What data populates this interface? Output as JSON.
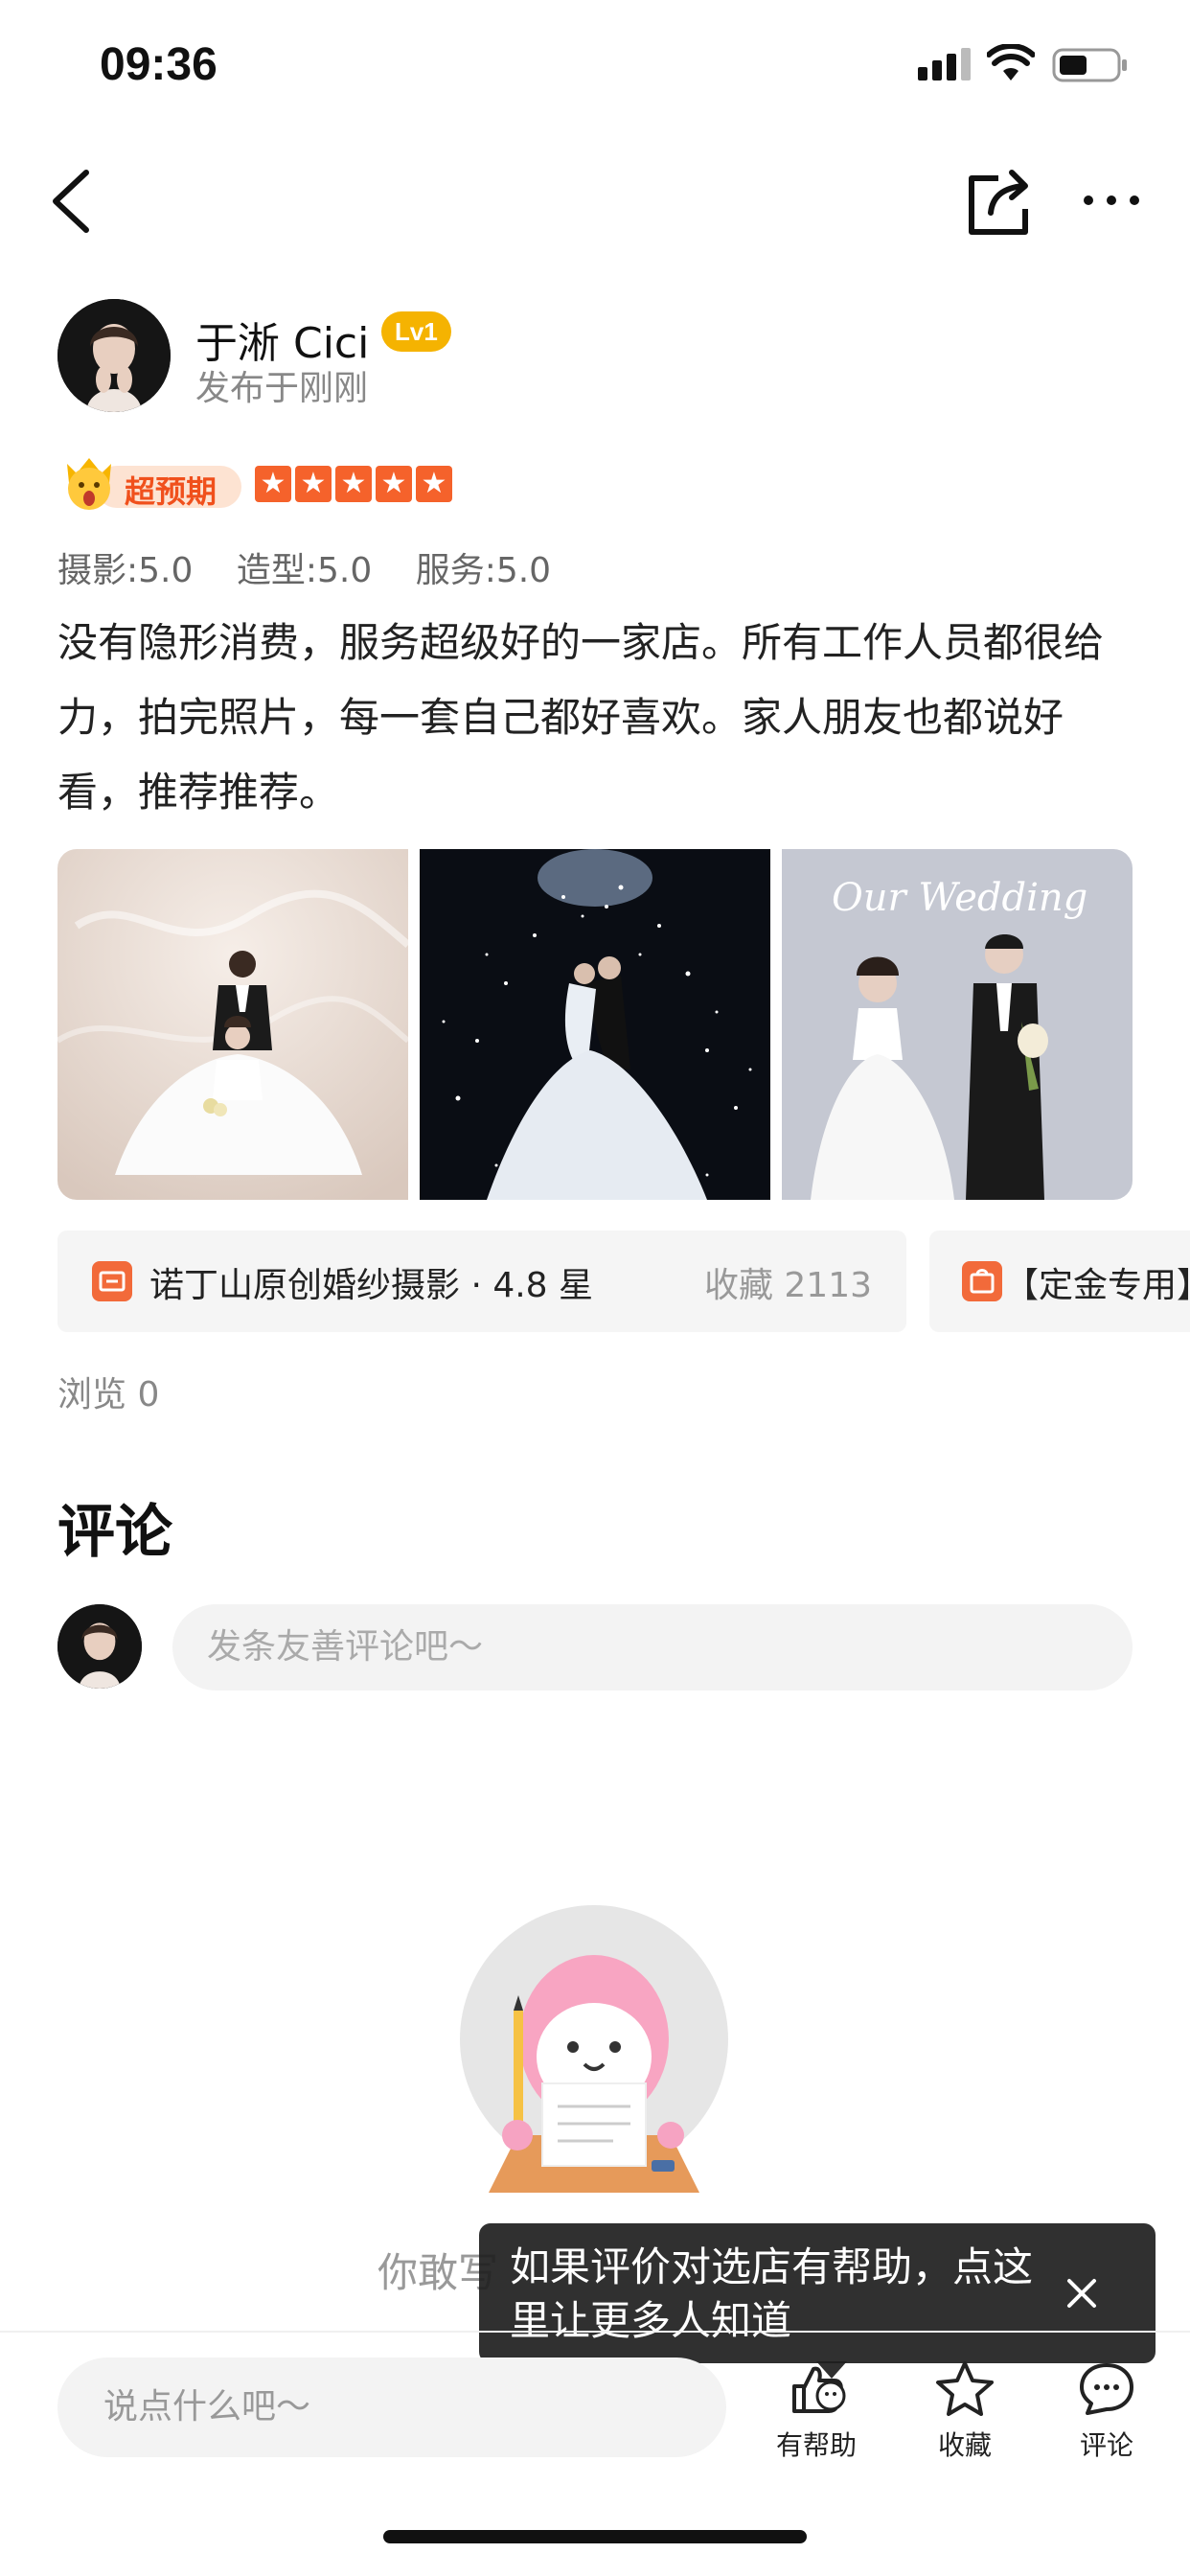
{
  "status_bar": {
    "time": "09:36"
  },
  "author": {
    "name": "于淅 Cici",
    "level": "Lv1",
    "post_time": "发布于刚刚"
  },
  "rating": {
    "tag": "超预期",
    "stars": 5,
    "star_color": "#f5622b",
    "sub_scores": [
      "摄影:5.0",
      "造型:5.0",
      "服务:5.0"
    ]
  },
  "review": {
    "text": "没有隐形消费，服务超级好的一家店。所有工作人员都很给力，拍完照片，每一套自己都好喜欢。家人朋友也都说好看，推荐推荐。"
  },
  "photos": {
    "overlay_text": "Our Wedding"
  },
  "shops": [
    {
      "name": "诺丁山原创婚纱摄影 · 4.8 星",
      "fav": "收藏 2113"
    },
    {
      "name": "【定金专用】"
    }
  ],
  "views": "浏览 0",
  "comments": {
    "title": "评论",
    "input_placeholder": "发条友善评论吧～",
    "empty_text": "你敢写"
  },
  "tooltip": {
    "text": "如果评价对选店有帮助，点这里让更多人知道"
  },
  "bottom_bar": {
    "input_placeholder": "说点什么吧～",
    "helpful_label": "有帮助",
    "fav_label": "收藏",
    "comment_label": "评论"
  },
  "colors": {
    "accent": "#f26a3a",
    "badge": "#f5b301",
    "pink": "#f6a3c2"
  }
}
